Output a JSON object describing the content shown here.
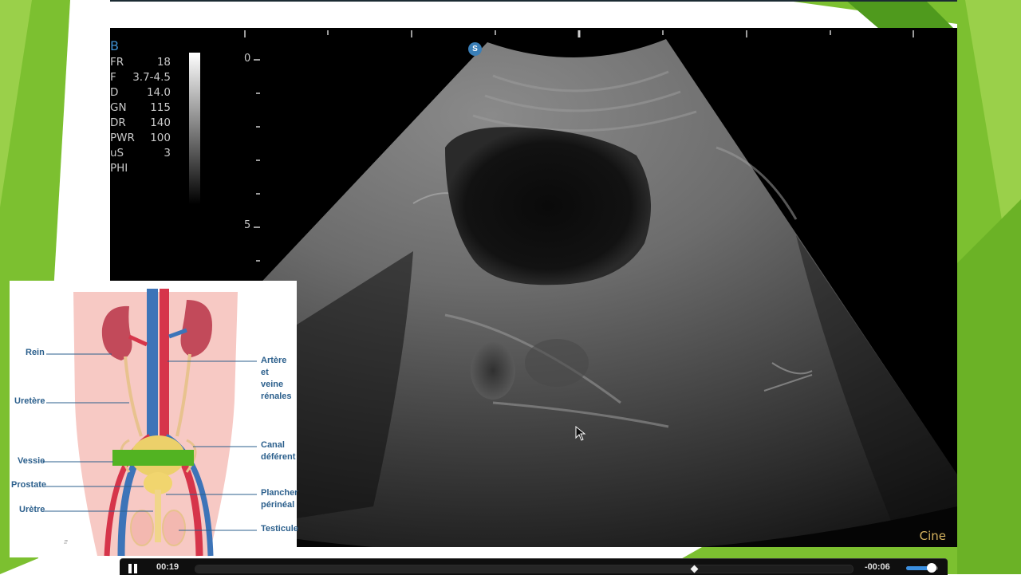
{
  "colors": {
    "slide_green": "#7cc030",
    "slide_green_dark": "#4f9a1d",
    "ultrasound_bg": "#000000",
    "mode_label": "#3f8fd1",
    "cine_label": "#d7b460",
    "anatomy_label": "#2b5f8c",
    "anatomy_highlight": "#52b322",
    "player_accent": "#3b8fe0"
  },
  "ultrasound": {
    "mode": "B",
    "params": [
      {
        "key": "FR",
        "value": "18"
      },
      {
        "key": "F",
        "value": "3.7-4.5"
      },
      {
        "key": "D",
        "value": "14.0"
      },
      {
        "key": "GN",
        "value": "115"
      },
      {
        "key": "DR",
        "value": "140"
      },
      {
        "key": "PWR",
        "value": "100"
      },
      {
        "key": "uS",
        "value": "3"
      },
      {
        "key": "PHI",
        "value": ""
      }
    ],
    "depth_labels": [
      "0",
      "5"
    ],
    "probe_badge": "S",
    "cine_label": "Cine"
  },
  "anatomy": {
    "labels": {
      "rein": "Rein",
      "uretere": "Uretère",
      "vessie": "Vessie",
      "prostate": "Prostate",
      "uretre": "Urètre",
      "artere_l1": "Artère et",
      "artere_l2": "veine",
      "artere_l3": "rénales",
      "canal_l1": "Canal",
      "canal_l2": "déférent",
      "plancher_l1": "Plancher",
      "plancher_l2": "périnéal",
      "testicule": "Testicule"
    },
    "icon": "urinary-system-diagram"
  },
  "player": {
    "elapsed": "00:19",
    "remaining": "-00:06",
    "progress": 0.76,
    "volume": 0.8,
    "pause_icon": "pause-icon"
  }
}
